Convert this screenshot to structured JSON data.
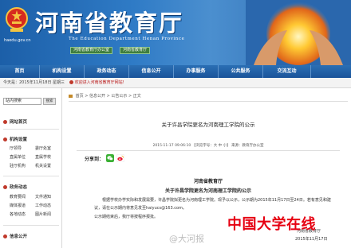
{
  "header": {
    "title": "河南省教育厅",
    "subtitle": "The Education Department Henan Province",
    "emblem_url": "haedu.gov.cn",
    "sub_links": [
      "河南省教育厅办公室",
      "河南省教育厅"
    ]
  },
  "nav": {
    "items": [
      "首页",
      "机构设置",
      "政务动态",
      "信息公开",
      "办事服务",
      "公共服务",
      "交流互动"
    ]
  },
  "infobar": {
    "date_label": "今天是：2015年11月18日 星期三",
    "welcome": "欢迎进入河南省教育厅网站!"
  },
  "sidebar": {
    "search_placeholder": "站内搜索",
    "search_button": "搜索",
    "sections": [
      {
        "title": "网站首页"
      },
      {
        "title": "机构设置",
        "items": [
          "厅领导",
          "委厅处室",
          "直属单位",
          "直属学校",
          "驻厅机构",
          "机关设置"
        ]
      },
      {
        "title": "政务动态",
        "items": [
          "教育要闻",
          "文件通知",
          "媒体报道",
          "工作动态",
          "各地动态",
          "图片新闻"
        ]
      },
      {
        "title": "信息公开"
      }
    ]
  },
  "main": {
    "breadcrumb": [
      "首页",
      "信息公开",
      "公告公示",
      "正文"
    ],
    "article_title": "关于许昌学院更名为河南理工学院的公示",
    "meta": "2015-11-17 09:06:10 【浏览字号：大 中 小】 来源：教育厅办公室",
    "share_label": "分享到：",
    "doc_org": "河南省教育厅",
    "doc_title": "关于许昌学院更名为河南理工学院的公示",
    "paragraph": "根据学校办学实际和发展需要，许昌学院拟更名为河南理工学院。现予以公示，公示期为2015年11月17日至24日。若有意见和建议，请在公示期内将意见发至haiyucs@163.com。",
    "paragraph2": "公示期结束后，我厅将按程序报批。",
    "sign_org": "河南省教育厅",
    "sign_date": "2015年11月17日"
  },
  "watermarks": {
    "red_text": "中国大学在线",
    "dahe_text": "@大河报"
  },
  "colors": {
    "nav_blue": "#1b549a",
    "banner_blue": "#2f7bc6",
    "accent_red": "#c0392b",
    "watermark_red": "#e60012"
  }
}
